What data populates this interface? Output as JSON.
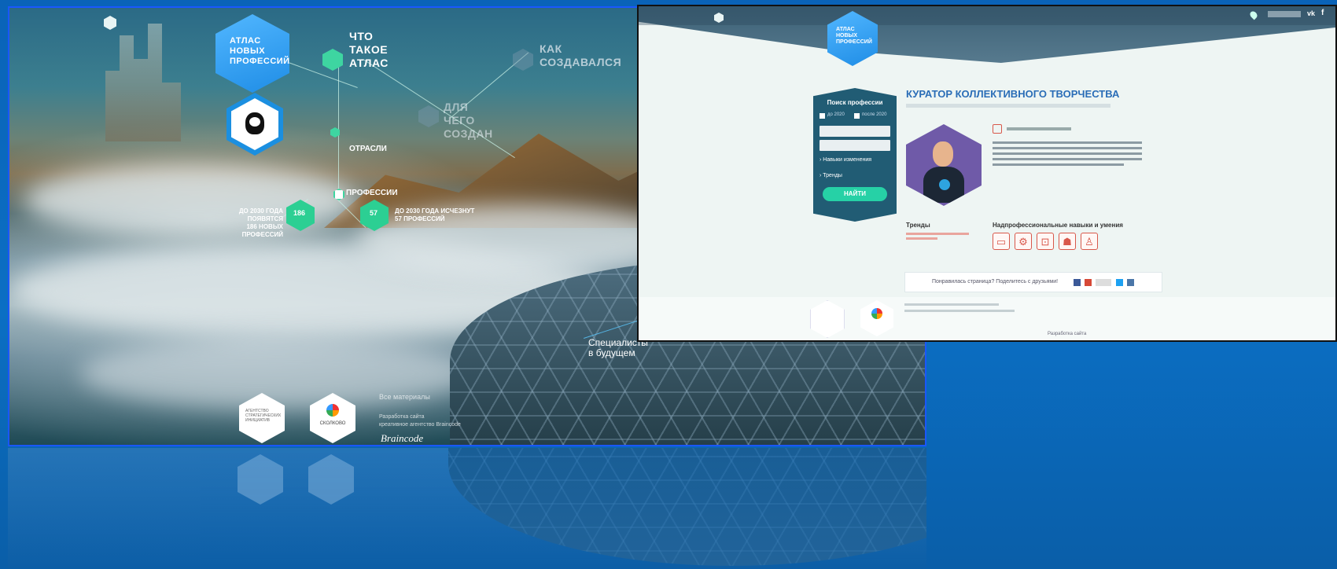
{
  "left_site": {
    "logo_title_lines": [
      "АТЛАС",
      "НОВЫХ",
      "ПРОФЕССИЙ"
    ],
    "nav": {
      "what_is_atlas": [
        "ЧТО",
        "ТАКОЕ",
        "АТЛАС"
      ],
      "how_created": [
        "КАК",
        "СОЗДАВАЛСЯ"
      ],
      "for_what_created": [
        "ДЛЯ",
        "ЧЕГО",
        "СОЗДАН"
      ],
      "industries": "ОТРАСЛИ",
      "professions": "ПРОФЕССИИ"
    },
    "stat_new": {
      "caption_lines": [
        "ДО 2030 ГОДА ПОЯВЯТСЯ",
        "186 НОВЫХ ПРОФЕССИЙ"
      ],
      "value": "186"
    },
    "stat_gone": {
      "caption_lines": [
        "ДО 2030 ГОДА ИСЧЕЗНУТ",
        "57 ПРОФЕССИЙ"
      ],
      "value": "57"
    },
    "future_specialists": [
      "Специалисты",
      "в будущем"
    ],
    "footer": {
      "materials": "Все материалы",
      "dev_lines": [
        "Разработка сайта",
        "креативное агентство Braincode"
      ],
      "partner1": "АГЕНТСТВО СТРАТЕГИЧЕСКИХ ИНИЦИАТИВ",
      "partner2": "СКОЛКОВО"
    }
  },
  "right_site": {
    "logo_title_lines": [
      "АТЛАС",
      "НОВЫХ",
      "ПРОФЕССИЙ"
    ],
    "page_title": "КУРАТОР КОЛЛЕКТИВНОГО ТВОРЧЕСТВА",
    "search": {
      "title": "Поиск профессии",
      "checkbox1": "до 2020",
      "checkbox2": "после 2020",
      "select1": "",
      "select2": "",
      "link_changes": "Навыки изменения",
      "link_trends": "Тренды",
      "button": "НАЙТИ"
    },
    "sections": {
      "trends_title": "Тренды",
      "skills_title": "Надпрофессиональные навыки и умения"
    },
    "share_text": "Понравилась страница? Поделитесь с друзьями!",
    "footer_dev": "Разработка сайта",
    "colors": {
      "accent": "#26d1a6",
      "title_blue": "#2a6db7",
      "skill_red": "#d8584b",
      "sidebar": "#215c74"
    }
  }
}
